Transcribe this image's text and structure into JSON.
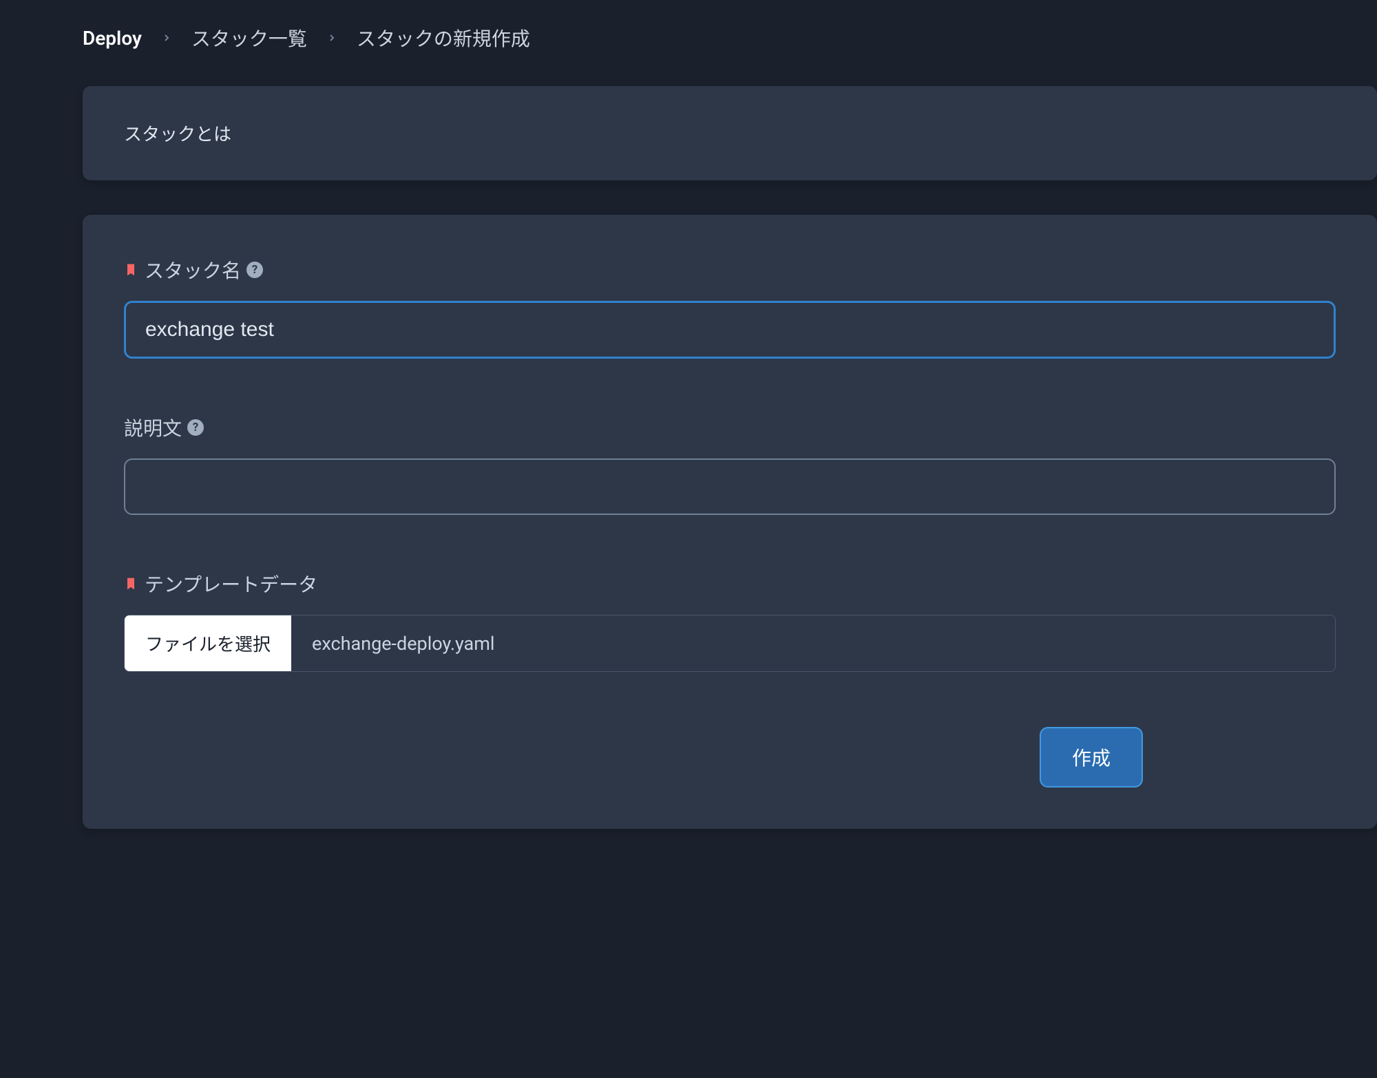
{
  "breadcrumb": {
    "root": "Deploy",
    "level1": "スタック一覧",
    "current": "スタックの新規作成"
  },
  "info_card": {
    "title": "スタックとは"
  },
  "form": {
    "stack_name": {
      "label": "スタック名",
      "value": "exchange test"
    },
    "description": {
      "label": "説明文",
      "value": ""
    },
    "template_data": {
      "label": "テンプレートデータ",
      "file_button": "ファイルを選択",
      "file_name": "exchange-deploy.yaml"
    },
    "create_button": "作成"
  }
}
